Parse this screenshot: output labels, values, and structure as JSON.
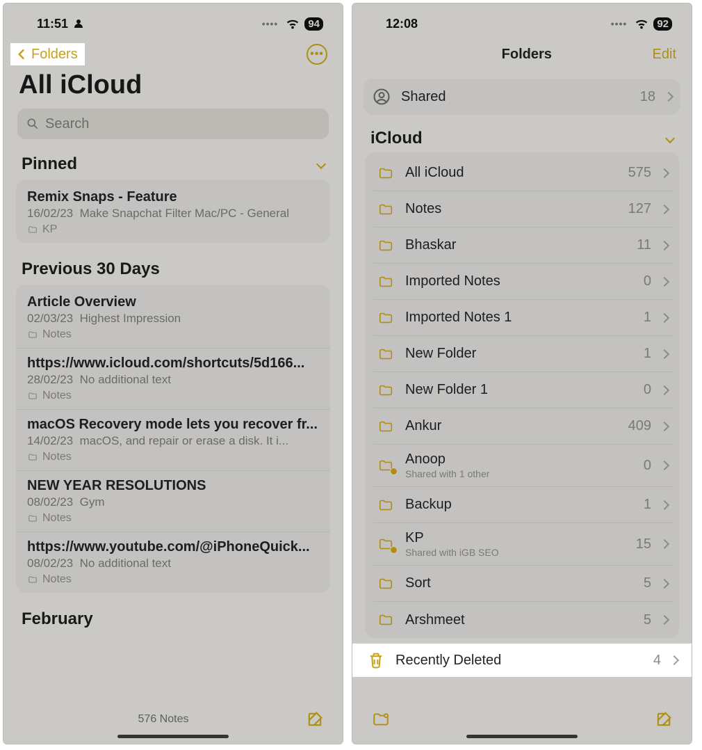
{
  "left": {
    "status_time": "11:51",
    "battery": "94",
    "back_label": "Folders",
    "title": "All iCloud",
    "search_placeholder": "Search",
    "pinned_label": "Pinned",
    "pinned_note": {
      "title": "Remix Snaps - Feature",
      "date": "16/02/23",
      "preview": "Make Snapchat Filter Mac/PC - General",
      "folder": "KP"
    },
    "prev30_label": "Previous 30 Days",
    "notes": [
      {
        "title": "Article Overview",
        "date": "02/03/23",
        "preview": "Highest Impression",
        "folder": "Notes"
      },
      {
        "title": "https://www.icloud.com/shortcuts/5d166...",
        "date": "28/02/23",
        "preview": "No additional text",
        "folder": "Notes"
      },
      {
        "title": "macOS Recovery mode lets you recover fr...",
        "date": "14/02/23",
        "preview": "macOS, and repair or erase a disk. It i...",
        "folder": "Notes"
      },
      {
        "title": "NEW YEAR RESOLUTIONS",
        "date": "08/02/23",
        "preview": "Gym",
        "folder": "Notes"
      },
      {
        "title": "https://www.youtube.com/@iPhoneQuick...",
        "date": "08/02/23",
        "preview": "No additional text",
        "folder": "Notes"
      }
    ],
    "feb_label": "February",
    "footer_count": "576 Notes"
  },
  "right": {
    "status_time": "12:08",
    "battery": "92",
    "title": "Folders",
    "edit": "Edit",
    "shared": {
      "label": "Shared",
      "count": "18"
    },
    "section": "iCloud",
    "folders": [
      {
        "name": "All iCloud",
        "count": "575",
        "shared": ""
      },
      {
        "name": "Notes",
        "count": "127",
        "shared": ""
      },
      {
        "name": "Bhaskar",
        "count": "11",
        "shared": ""
      },
      {
        "name": "Imported Notes",
        "count": "0",
        "shared": ""
      },
      {
        "name": "Imported Notes 1",
        "count": "1",
        "shared": ""
      },
      {
        "name": "New Folder",
        "count": "1",
        "shared": ""
      },
      {
        "name": "New Folder 1",
        "count": "0",
        "shared": ""
      },
      {
        "name": "Ankur",
        "count": "409",
        "shared": ""
      },
      {
        "name": "Anoop",
        "count": "0",
        "shared": "Shared with 1 other"
      },
      {
        "name": "Backup",
        "count": "1",
        "shared": ""
      },
      {
        "name": "KP",
        "count": "15",
        "shared": "Shared with iGB SEO"
      },
      {
        "name": "Sort",
        "count": "5",
        "shared": ""
      },
      {
        "name": "Arshmeet",
        "count": "5",
        "shared": ""
      }
    ],
    "deleted": {
      "label": "Recently Deleted",
      "count": "4"
    }
  }
}
